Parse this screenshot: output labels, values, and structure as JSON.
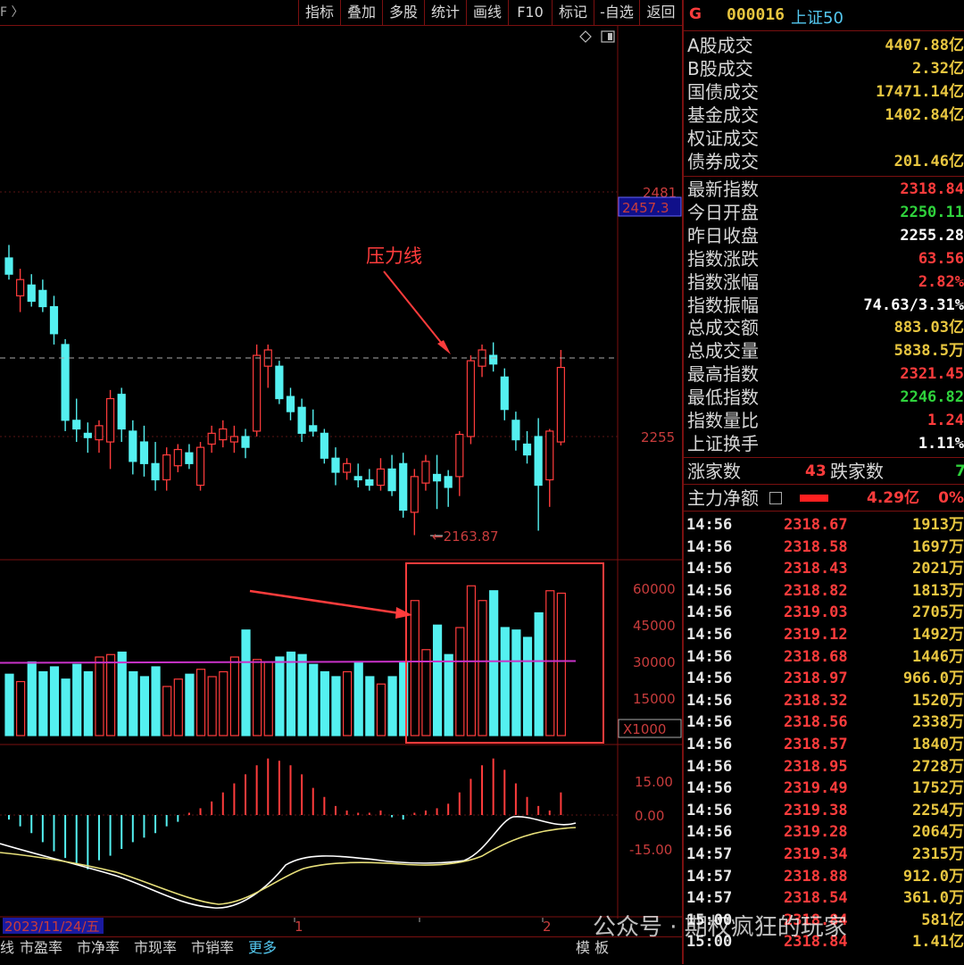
{
  "toolbar": {
    "crumb": "F 〉",
    "items": [
      "指标",
      "叠加",
      "多股",
      "统计",
      "画线",
      "F10",
      "标记",
      "-自选",
      "返回"
    ]
  },
  "header": {
    "code_prefix": "G",
    "code": "000016",
    "name": "上证50"
  },
  "market_turnover": [
    {
      "label": "A股成交",
      "value": "4407.88亿"
    },
    {
      "label": "B股成交",
      "value": "2.32亿"
    },
    {
      "label": "国债成交",
      "value": "17471.14亿"
    },
    {
      "label": "基金成交",
      "value": "1402.84亿"
    },
    {
      "label": "权证成交",
      "value": ""
    },
    {
      "label": "债券成交",
      "value": "201.46亿"
    }
  ],
  "index_stats": [
    {
      "label": "最新指数",
      "value": "2318.84",
      "color": "#ff3c3c"
    },
    {
      "label": "今日开盘",
      "value": "2250.11",
      "color": "#2fd23c"
    },
    {
      "label": "昨日收盘",
      "value": "2255.28",
      "color": "#ffffff"
    },
    {
      "label": "指数涨跌",
      "value": "63.56",
      "color": "#ff3c3c"
    },
    {
      "label": "指数涨幅",
      "value": "2.82%",
      "color": "#ff3c3c"
    },
    {
      "label": "指数振幅",
      "value": "74.63/3.31%",
      "color": "#ffffff"
    },
    {
      "label": "总成交额",
      "value": "883.03亿",
      "color": "#e8c640"
    },
    {
      "label": "总成交量",
      "value": "5838.5万",
      "color": "#e8c640"
    },
    {
      "label": "最高指数",
      "value": "2321.45",
      "color": "#ff3c3c"
    },
    {
      "label": "最低指数",
      "value": "2246.82",
      "color": "#2fd23c"
    },
    {
      "label": "指数量比",
      "value": "1.24",
      "color": "#ff3c3c"
    },
    {
      "label": "上证换手",
      "value": "1.11%",
      "color": "#ffffff"
    }
  ],
  "breadth": {
    "up_label": "涨家数",
    "up_value": "43",
    "down_label": "跌家数",
    "down_value": "7"
  },
  "main_flow": {
    "label": "主力净额",
    "value": "4.29亿",
    "percent": "0%"
  },
  "ticks": [
    {
      "time": "14:56",
      "price": "2318.67",
      "vol": "1913万"
    },
    {
      "time": "14:56",
      "price": "2318.58",
      "vol": "1697万"
    },
    {
      "time": "14:56",
      "price": "2318.43",
      "vol": "2021万"
    },
    {
      "time": "14:56",
      "price": "2318.82",
      "vol": "1813万"
    },
    {
      "time": "14:56",
      "price": "2319.03",
      "vol": "2705万"
    },
    {
      "time": "14:56",
      "price": "2319.12",
      "vol": "1492万"
    },
    {
      "time": "14:56",
      "price": "2318.68",
      "vol": "1446万"
    },
    {
      "time": "14:56",
      "price": "2318.97",
      "vol": "966.0万"
    },
    {
      "time": "14:56",
      "price": "2318.32",
      "vol": "1520万"
    },
    {
      "time": "14:56",
      "price": "2318.56",
      "vol": "2338万"
    },
    {
      "time": "14:56",
      "price": "2318.57",
      "vol": "1840万"
    },
    {
      "time": "14:56",
      "price": "2318.95",
      "vol": "2728万"
    },
    {
      "time": "14:56",
      "price": "2319.49",
      "vol": "1752万"
    },
    {
      "time": "14:56",
      "price": "2319.38",
      "vol": "2254万"
    },
    {
      "time": "14:56",
      "price": "2319.28",
      "vol": "2064万"
    },
    {
      "time": "14:57",
      "price": "2319.34",
      "vol": "2315万"
    },
    {
      "time": "14:57",
      "price": "2318.88",
      "vol": "912.0万"
    },
    {
      "time": "14:57",
      "price": "2318.54",
      "vol": "361.0万"
    },
    {
      "time": "15:00",
      "price": "2318.84",
      "vol": "581亿"
    },
    {
      "time": "15:00",
      "price": "2318.84",
      "vol": "1.41亿"
    }
  ],
  "chart": {
    "price_labels": {
      "high": "2481",
      "current": "2457.3",
      "mid": "2255",
      "low_mark": "2163.87"
    },
    "annotation": "压力线",
    "volume_ticks": [
      "60000",
      "45000",
      "30000",
      "15000"
    ],
    "volume_unit": "X1000",
    "macd_ticks": [
      "15.00",
      "0.00",
      "-15.00"
    ],
    "date_label": "2023/11/24/五",
    "month_marks": [
      "1",
      "2"
    ]
  },
  "bottom_tabs": [
    "线",
    "市盈率",
    "市净率",
    "市现率",
    "市销率",
    "更多"
  ],
  "bottom_right": {
    "template": "模 板",
    "plus": "+",
    "minus": "-"
  },
  "watermark": "公众号 · 期权疯狂的玩家",
  "colors": {
    "up": "#ff3c3c",
    "down": "#54f0f0",
    "grid": "#7a1010",
    "ma": "#c832c8"
  },
  "chart_data": {
    "type": "candlestick",
    "candles": [
      {
        "o": 2420,
        "h": 2432,
        "l": 2400,
        "c": 2405
      },
      {
        "o": 2385,
        "h": 2410,
        "l": 2370,
        "c": 2400
      },
      {
        "o": 2395,
        "h": 2405,
        "l": 2375,
        "c": 2380
      },
      {
        "o": 2390,
        "h": 2400,
        "l": 2370,
        "c": 2375
      },
      {
        "o": 2375,
        "h": 2385,
        "l": 2340,
        "c": 2350
      },
      {
        "o": 2340,
        "h": 2345,
        "l": 2260,
        "c": 2270
      },
      {
        "o": 2270,
        "h": 2290,
        "l": 2250,
        "c": 2262
      },
      {
        "o": 2258,
        "h": 2268,
        "l": 2240,
        "c": 2254
      },
      {
        "o": 2252,
        "h": 2270,
        "l": 2240,
        "c": 2265
      },
      {
        "o": 2250,
        "h": 2298,
        "l": 2225,
        "c": 2290
      },
      {
        "o": 2294,
        "h": 2300,
        "l": 2250,
        "c": 2262
      },
      {
        "o": 2260,
        "h": 2270,
        "l": 2220,
        "c": 2232
      },
      {
        "o": 2250,
        "h": 2265,
        "l": 2218,
        "c": 2230
      },
      {
        "o": 2230,
        "h": 2250,
        "l": 2205,
        "c": 2215
      },
      {
        "o": 2215,
        "h": 2245,
        "l": 2205,
        "c": 2238
      },
      {
        "o": 2228,
        "h": 2248,
        "l": 2222,
        "c": 2243
      },
      {
        "o": 2240,
        "h": 2248,
        "l": 2225,
        "c": 2230
      },
      {
        "o": 2210,
        "h": 2250,
        "l": 2205,
        "c": 2245
      },
      {
        "o": 2248,
        "h": 2265,
        "l": 2240,
        "c": 2258
      },
      {
        "o": 2252,
        "h": 2270,
        "l": 2245,
        "c": 2262
      },
      {
        "o": 2250,
        "h": 2265,
        "l": 2240,
        "c": 2255
      },
      {
        "o": 2255,
        "h": 2262,
        "l": 2235,
        "c": 2245
      },
      {
        "o": 2260,
        "h": 2340,
        "l": 2255,
        "c": 2330
      },
      {
        "o": 2320,
        "h": 2340,
        "l": 2300,
        "c": 2335
      },
      {
        "o": 2320,
        "h": 2325,
        "l": 2285,
        "c": 2290
      },
      {
        "o": 2292,
        "h": 2300,
        "l": 2270,
        "c": 2278
      },
      {
        "o": 2282,
        "h": 2290,
        "l": 2250,
        "c": 2258
      },
      {
        "o": 2265,
        "h": 2280,
        "l": 2255,
        "c": 2260
      },
      {
        "o": 2258,
        "h": 2262,
        "l": 2230,
        "c": 2235
      },
      {
        "o": 2235,
        "h": 2245,
        "l": 2210,
        "c": 2222
      },
      {
        "o": 2222,
        "h": 2235,
        "l": 2215,
        "c": 2230
      },
      {
        "o": 2218,
        "h": 2230,
        "l": 2208,
        "c": 2215
      },
      {
        "o": 2215,
        "h": 2225,
        "l": 2205,
        "c": 2210
      },
      {
        "o": 2210,
        "h": 2235,
        "l": 2205,
        "c": 2225
      },
      {
        "o": 2225,
        "h": 2238,
        "l": 2200,
        "c": 2205
      },
      {
        "o": 2230,
        "h": 2240,
        "l": 2180,
        "c": 2187
      },
      {
        "o": 2185,
        "h": 2225,
        "l": 2163.87,
        "c": 2218
      },
      {
        "o": 2212,
        "h": 2238,
        "l": 2205,
        "c": 2232
      },
      {
        "o": 2220,
        "h": 2238,
        "l": 2188,
        "c": 2214
      },
      {
        "o": 2218,
        "h": 2224,
        "l": 2190,
        "c": 2208
      },
      {
        "o": 2218,
        "h": 2260,
        "l": 2200,
        "c": 2257
      },
      {
        "o": 2255,
        "h": 2330,
        "l": 2248,
        "c": 2325
      },
      {
        "o": 2320,
        "h": 2340,
        "l": 2310,
        "c": 2335
      },
      {
        "o": 2330,
        "h": 2342,
        "l": 2315,
        "c": 2322
      },
      {
        "o": 2310,
        "h": 2318,
        "l": 2270,
        "c": 2280
      },
      {
        "o": 2270,
        "h": 2278,
        "l": 2242,
        "c": 2252
      },
      {
        "o": 2248,
        "h": 2260,
        "l": 2230,
        "c": 2238
      },
      {
        "o": 2255,
        "h": 2272,
        "l": 2168,
        "c": 2210
      },
      {
        "o": 2215,
        "h": 2262,
        "l": 2190,
        "c": 2260
      },
      {
        "o": 2250,
        "h": 2335,
        "l": 2246.82,
        "c": 2318.84
      }
    ],
    "volumes": [
      25000,
      22000,
      30000,
      26000,
      28000,
      23000,
      29000,
      26000,
      32000,
      33000,
      34000,
      26000,
      24000,
      28000,
      20000,
      23000,
      25000,
      27000,
      24000,
      26000,
      32000,
      43000,
      31000,
      30000,
      32000,
      34000,
      33000,
      29000,
      26000,
      24000,
      26000,
      30000,
      24000,
      21000,
      24000,
      30000,
      55000,
      35000,
      45000,
      33000,
      44000,
      61000,
      55000,
      59000,
      44000,
      43000,
      40000,
      50000,
      59000,
      58000
    ],
    "volume_ma": 30000,
    "macd_hist": [
      -2,
      -5,
      -8,
      -12,
      -16,
      -19,
      -22,
      -24,
      -20,
      -18,
      -15,
      -12,
      -10,
      -8,
      -5,
      -3,
      1,
      3,
      6,
      10,
      14,
      18,
      22,
      25,
      24,
      22,
      18,
      12,
      8,
      4,
      2,
      1,
      1,
      2,
      -1,
      -2,
      1,
      2,
      3,
      5,
      10,
      16,
      22,
      25,
      20,
      14,
      8,
      4,
      2,
      10
    ],
    "y_range": [
      2150,
      2500
    ],
    "volume_range": [
      0,
      70000
    ],
    "macd_range": [
      -25,
      25
    ]
  }
}
